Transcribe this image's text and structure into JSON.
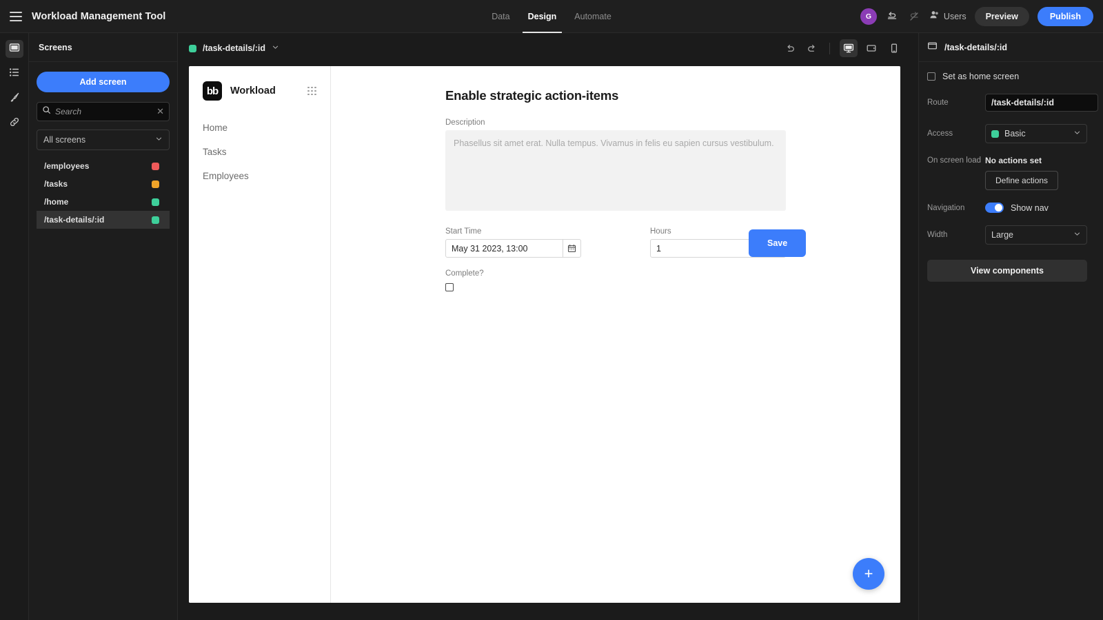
{
  "topbar": {
    "menu_icon": "hamburger-icon",
    "app_title": "Workload Management Tool",
    "tabs": [
      {
        "label": "Data",
        "active": false
      },
      {
        "label": "Design",
        "active": true
      },
      {
        "label": "Automate",
        "active": false
      }
    ],
    "avatar_initial": "G",
    "undo_icon": "undo-icon",
    "redo_icon": "redo-disabled-icon",
    "users_icon": "users-icon",
    "users_label": "Users",
    "preview_label": "Preview",
    "publish_label": "Publish",
    "publish_color": "#3c7dfb"
  },
  "rail": {
    "items": [
      {
        "icon": "screens-icon",
        "active": true
      },
      {
        "icon": "list-icon",
        "active": false
      },
      {
        "icon": "theme-brush-icon",
        "active": false
      },
      {
        "icon": "link-icon",
        "active": false
      }
    ]
  },
  "screens_panel": {
    "title": "Screens",
    "add_screen_label": "Add screen",
    "search": {
      "placeholder": "Search",
      "value": "",
      "clear_icon": "clear-icon"
    },
    "filter": {
      "value": "All screens"
    },
    "screens": [
      {
        "route": "/employees",
        "color": "#ef5a5a"
      },
      {
        "route": "/tasks",
        "color": "#f0a429"
      },
      {
        "route": "/home",
        "color": "#3ecf9a"
      },
      {
        "route": "/task-details/:id",
        "color": "#3ecf9a",
        "selected": true
      }
    ]
  },
  "canvas": {
    "route_chip": {
      "label": "/task-details/:id",
      "color": "#3ecf9a",
      "chevron": "chevron-down-icon"
    },
    "undo_icon": "undo-icon",
    "redo_icon": "redo-icon",
    "devices": [
      {
        "name": "desktop-icon",
        "active": true
      },
      {
        "name": "tablet-icon",
        "active": false
      },
      {
        "name": "mobile-icon",
        "active": false
      }
    ]
  },
  "app_preview": {
    "logo_text": "bb",
    "app_name": "Workload",
    "grid_icon": "grid-dots-icon",
    "nav_links": [
      {
        "label": "Home"
      },
      {
        "label": "Tasks"
      },
      {
        "label": "Employees"
      }
    ],
    "form": {
      "title": "Enable strategic action-items",
      "description_label": "Description",
      "description_placeholder": "Phasellus sit amet erat. Nulla tempus. Vivamus in felis eu sapien cursus vestibulum.",
      "description_value": "",
      "start_time_label": "Start Time",
      "start_time_value": "May 31 2023, 13:00",
      "calendar_icon": "calendar-icon",
      "hours_label": "Hours",
      "hours_value": "1",
      "complete_label": "Complete?",
      "complete_checked": false,
      "save_label": "Save"
    },
    "fab": {
      "icon": "plus-icon",
      "color": "#3c7dfb"
    }
  },
  "right_panel": {
    "header_icon": "screen-icon",
    "header_title": "/task-details/:id",
    "home_checkbox_label": "Set as home screen",
    "home_checkbox_checked": false,
    "route_label": "Route",
    "route_value": "/task-details/:id",
    "access_label": "Access",
    "access_value": "Basic",
    "access_color": "#3ecf9a",
    "onload_label": "On screen load",
    "onload_value": "No actions set",
    "define_actions_label": "Define actions",
    "navigation_label": "Navigation",
    "nav_toggle_label": "Show nav",
    "nav_toggle_on": true,
    "width_label": "Width",
    "width_value": "Large",
    "view_components_label": "View components"
  }
}
